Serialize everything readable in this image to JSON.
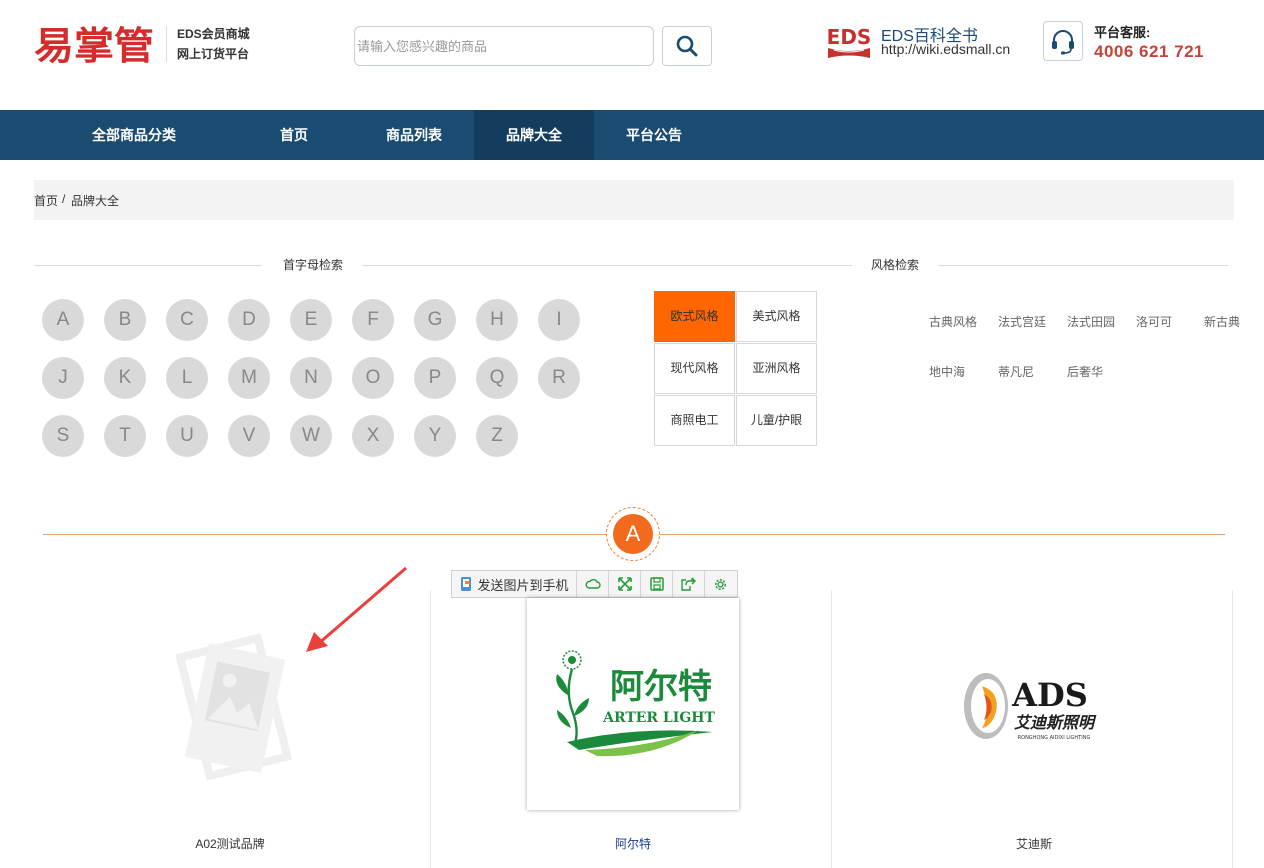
{
  "header": {
    "logo_text": "易掌管",
    "logo_line1": "EDS会员商城",
    "logo_line2": "网上订货平台",
    "search_placeholder": "请输入您感兴趣的商品",
    "eds_logo_text": "EDS",
    "eds_title": "EDS百科全书",
    "eds_url": "http://wiki.edsmall.cn",
    "service_label": "平台客服:",
    "service_phone": "4006 621 721",
    "accent_color": "#c8413a"
  },
  "nav": {
    "items": [
      {
        "label": "全部商品分类"
      },
      {
        "label": "首页"
      },
      {
        "label": "商品列表"
      },
      {
        "label": "品牌大全",
        "active": true
      },
      {
        "label": "平台公告"
      }
    ],
    "bg_color": "#1a4b71"
  },
  "breadcrumb": {
    "home": "首页",
    "sep": "/",
    "current": "品牌大全"
  },
  "letter_search": {
    "title": "首字母检索",
    "letters": [
      "A",
      "B",
      "C",
      "D",
      "E",
      "F",
      "G",
      "H",
      "I",
      "J",
      "K",
      "L",
      "M",
      "N",
      "O",
      "P",
      "Q",
      "R",
      "S",
      "T",
      "U",
      "V",
      "W",
      "X",
      "Y",
      "Z"
    ]
  },
  "style_search": {
    "title": "风格检索",
    "grid": [
      "欧式风格",
      "美式风格",
      "现代风格",
      "亚洲风格",
      "商照电工",
      "儿童/护眼"
    ],
    "active": "欧式风格",
    "sub_styles": [
      "古典风格",
      "法式宫廷",
      "法式田园",
      "洛可可",
      "新古典",
      "地中海",
      "蒂凡尼",
      "后奢华"
    ]
  },
  "section": {
    "letter": "A",
    "brands": [
      {
        "name": "A02测试品牌"
      },
      {
        "name": "阿尔特",
        "logo_cn": "阿尔特",
        "logo_en": "ARTER LIGHT"
      },
      {
        "name": "艾迪斯",
        "logo_en": "ADS",
        "logo_cn": "艾迪斯照明",
        "logo_sub": "RONGHONG AIDIXI LIGHTING"
      }
    ]
  },
  "image_toolbar": {
    "send_label": "发送图片到手机",
    "icons": [
      "cloud-icon",
      "fullscreen-icon",
      "save-icon",
      "share-icon",
      "settings-icon"
    ]
  }
}
